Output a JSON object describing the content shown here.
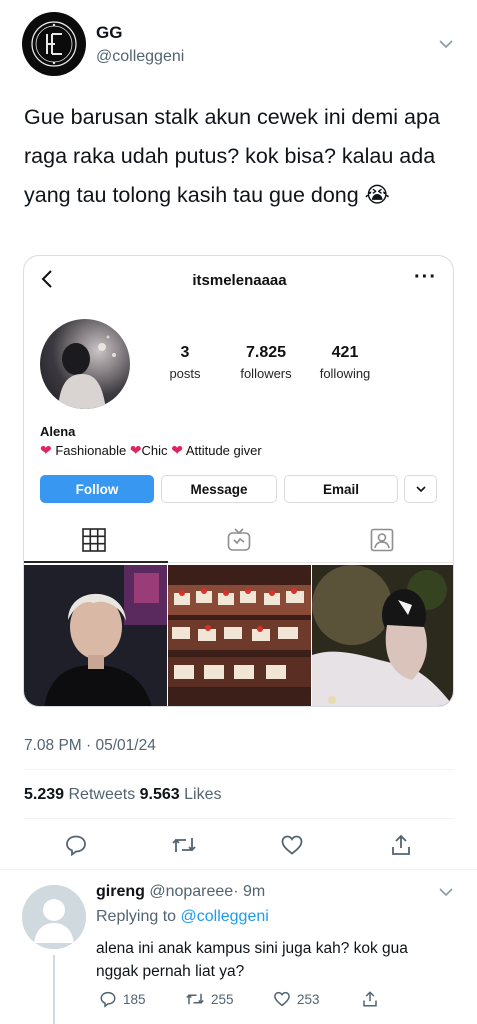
{
  "tweet": {
    "author_name": "GG",
    "author_handle": "@colleggeni",
    "text": "Gue barusan stalk akun cewek ini demi apa raga raka udah putus? kok bisa? kalau ada yang tau tolong kasih tau gue dong 😭",
    "timestamp": "7.08 PM · 05/01/24",
    "retweets_count": "5.239",
    "retweets_label": "Retweets",
    "likes_count": "9.563",
    "likes_label": "Likes"
  },
  "instagram": {
    "username": "itsmelenaaaa",
    "posts_count": "3",
    "posts_label": "posts",
    "followers_count": "7.825",
    "followers_label": "followers",
    "following_count": "421",
    "following_label": "following",
    "name": "Alena",
    "bio_1": "Fashionable",
    "bio_2": "Chic",
    "bio_3": "Attitude giver",
    "follow_label": "Follow",
    "message_label": "Message",
    "email_label": "Email"
  },
  "reply": {
    "name": "gireng",
    "handle": "@nopareee",
    "time": "· 9m",
    "replying_prefix": "Replying to",
    "replying_handle": "@colleggeni",
    "text": "alena ini anak kampus sini juga kah? kok gua nggak pernah liat ya?",
    "comments": "185",
    "retweets": "255",
    "likes": "253"
  },
  "colors": {
    "accent": "#1d9bf0",
    "follow_button": "#3897f0",
    "heart": "#e0245e",
    "muted": "#536471"
  },
  "icons": [
    "chevron-down-icon",
    "back-icon",
    "more-icon",
    "grid-icon",
    "igtv-icon",
    "tagged-icon",
    "reply-icon",
    "retweet-icon",
    "like-icon",
    "share-icon"
  ]
}
